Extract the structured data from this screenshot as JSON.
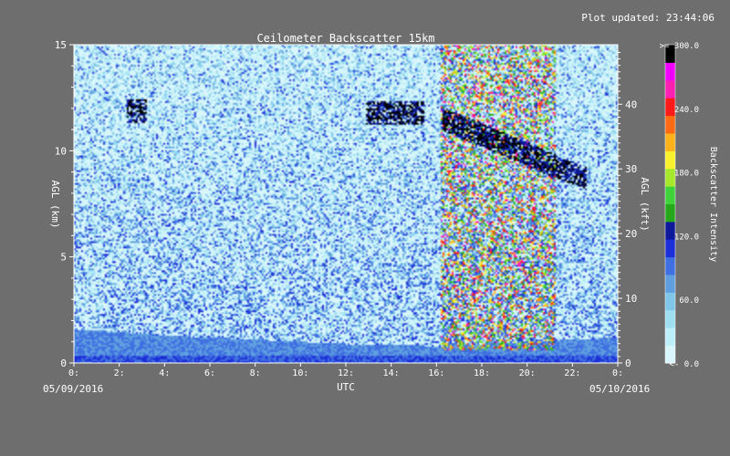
{
  "colors": {
    "background": "#6e6e6e",
    "text": "#ffffff",
    "colorscale": [
      "#d8f6fb",
      "#bdeffa",
      "#9fdff2",
      "#80c6e8",
      "#5f9fe0",
      "#3f6fe0",
      "#1d2fd8",
      "#0f1a9a",
      "#26a81a",
      "#3fd23a",
      "#a6e82b",
      "#f8f02a",
      "#ffb21a",
      "#ff6a12",
      "#ff1a1a",
      "#ff1fb0",
      "#f000ff",
      "#000000"
    ]
  },
  "plot_updated": "Plot updated: 23:44:06",
  "date_start": "05/09/2016",
  "date_end": "05/10/2016",
  "chart_data": {
    "type": "heatmap",
    "title": "Ceilometer Backscatter 15km",
    "xlabel": "UTC",
    "ylabel_left": "AGL (km)",
    "ylabel_right": "AGL (kft)",
    "xlim": [
      0,
      24
    ],
    "ylim_km": [
      0,
      15
    ],
    "ylim_kft": [
      0,
      49.2
    ],
    "x_ticks": [
      {
        "value": 0,
        "label": "0:"
      },
      {
        "value": 2,
        "label": "2:"
      },
      {
        "value": 4,
        "label": "4:"
      },
      {
        "value": 6,
        "label": "6:"
      },
      {
        "value": 8,
        "label": "8:"
      },
      {
        "value": 10,
        "label": "10:"
      },
      {
        "value": 12,
        "label": "12:"
      },
      {
        "value": 14,
        "label": "14:"
      },
      {
        "value": 16,
        "label": "16:"
      },
      {
        "value": 18,
        "label": "18:"
      },
      {
        "value": 20,
        "label": "20:"
      },
      {
        "value": 22,
        "label": "22:"
      },
      {
        "value": 24,
        "label": "0:"
      }
    ],
    "y_ticks_left": [
      {
        "value": 0,
        "label": "0"
      },
      {
        "value": 5,
        "label": "5"
      },
      {
        "value": 10,
        "label": "10"
      },
      {
        "value": 15,
        "label": "15"
      }
    ],
    "y_ticks_right": [
      {
        "value": 0,
        "label": "0"
      },
      {
        "value": 10,
        "label": "10"
      },
      {
        "value": 20,
        "label": "20"
      },
      {
        "value": 30,
        "label": "30"
      },
      {
        "value": 40,
        "label": "40"
      }
    ],
    "colorbar": {
      "label": "Backscatter Intensity",
      "range": [
        0,
        300
      ],
      "ticks": [
        {
          "value": 0,
          "label": "<-   0.0"
        },
        {
          "value": 60,
          "label": "60.0"
        },
        {
          "value": 120,
          "label": "120.0"
        },
        {
          "value": 180,
          "label": "180.0"
        },
        {
          "value": 240,
          "label": "240.0"
        },
        {
          "value": 300,
          "label": ">= 300.0"
        }
      ]
    },
    "features": {
      "boundary_layer_km": [
        [
          0,
          1.6
        ],
        [
          4,
          1.3
        ],
        [
          8,
          1.1
        ],
        [
          12,
          0.9
        ],
        [
          16,
          0.8
        ],
        [
          20,
          1.0
        ],
        [
          24,
          1.2
        ]
      ],
      "high_clouds": [
        {
          "t_start": 2.3,
          "t_end": 3.2,
          "height_km": 11.9
        },
        {
          "t_start": 12.9,
          "t_end": 15.5,
          "height_km": 11.8
        },
        {
          "t_start": 16.3,
          "t_end": 22.6,
          "height_km": 11.5,
          "slope_km_per_h": -0.45
        }
      ],
      "precipitation_signal": {
        "t_start": 16.2,
        "t_end": 21.3
      }
    }
  }
}
